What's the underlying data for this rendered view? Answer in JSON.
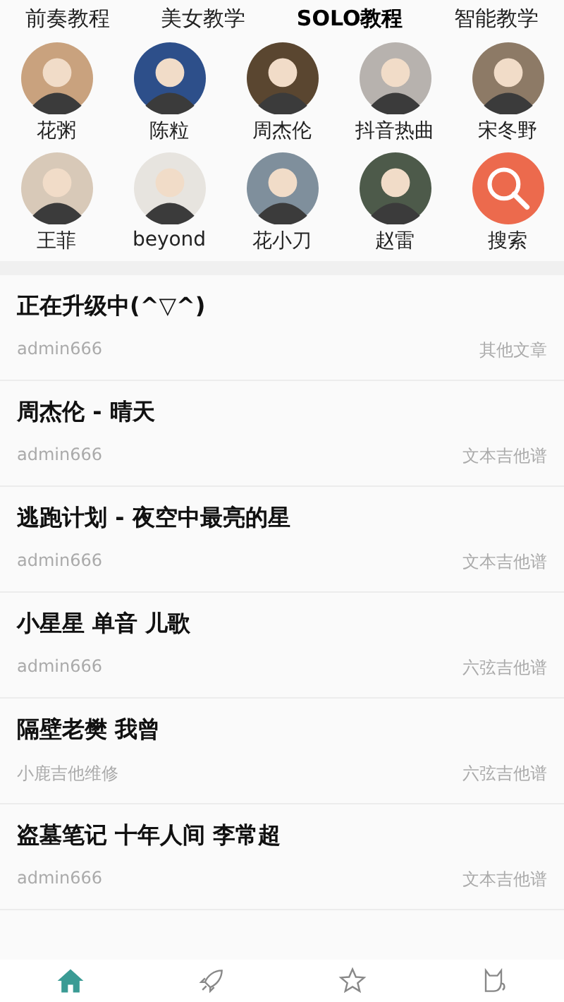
{
  "tabs": [
    {
      "label": "前奏教程",
      "selected": false
    },
    {
      "label": "美女教学",
      "selected": false
    },
    {
      "label": "SOLO教程",
      "selected": true
    },
    {
      "label": "智能教学",
      "selected": false
    }
  ],
  "artists": [
    {
      "kind": "avatar",
      "name": "花粥"
    },
    {
      "kind": "avatar",
      "name": "陈粒"
    },
    {
      "kind": "avatar",
      "name": "周杰伦"
    },
    {
      "kind": "avatar",
      "name": "抖音热曲"
    },
    {
      "kind": "avatar",
      "name": "宋冬野"
    },
    {
      "kind": "avatar",
      "name": "王菲"
    },
    {
      "kind": "avatar",
      "name": "beyond"
    },
    {
      "kind": "avatar",
      "name": "花小刀"
    },
    {
      "kind": "avatar",
      "name": "赵雷"
    },
    {
      "kind": "search",
      "name": "搜索"
    }
  ],
  "articles": [
    {
      "title": "正在升级中(^▽^)",
      "author": "admin666",
      "category": "其他文章"
    },
    {
      "title": "周杰伦 - 晴天",
      "author": "admin666",
      "category": "文本吉他谱"
    },
    {
      "title": "逃跑计划 - 夜空中最亮的星",
      "author": "admin666",
      "category": "文本吉他谱"
    },
    {
      "title": "小星星 单音 儿歌",
      "author": "admin666",
      "category": "六弦吉他谱"
    },
    {
      "title": "隔壁老樊 我曾",
      "author": "小鹿吉他维修",
      "category": "六弦吉他谱"
    },
    {
      "title": "盗墓笔记 十年人间 李常超",
      "author": "admin666",
      "category": "文本吉他谱"
    }
  ],
  "nav": [
    {
      "kind": "home",
      "selected": true
    },
    {
      "kind": "rocket",
      "selected": false
    },
    {
      "kind": "star",
      "selected": false
    },
    {
      "kind": "cat",
      "selected": false
    }
  ]
}
